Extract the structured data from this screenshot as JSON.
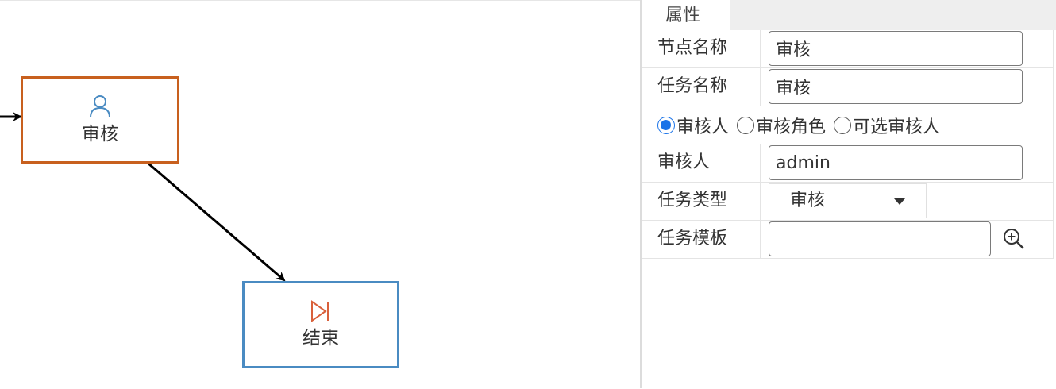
{
  "canvas": {
    "nodes": [
      {
        "id": "review",
        "label": "审核",
        "icon": "user-icon",
        "border_color": "#c8601e"
      },
      {
        "id": "end",
        "label": "结束",
        "icon": "end-event-icon",
        "border_color": "#4a8bc2"
      }
    ],
    "edge_color": "#000000"
  },
  "panel": {
    "tab_label": "属性",
    "fields": {
      "node_name": {
        "label": "节点名称",
        "value": "审核"
      },
      "task_name": {
        "label": "任务名称",
        "value": "审核"
      },
      "reviewer_mode": {
        "options": [
          "审核人",
          "审核角色",
          "可选审核人"
        ],
        "selected": "审核人"
      },
      "reviewer": {
        "label": "审核人",
        "value": "admin"
      },
      "task_type": {
        "label": "任务类型",
        "value": "审核",
        "icon": "chevron-down-icon"
      },
      "task_template": {
        "label": "任务模板",
        "value": "",
        "icon": "zoom-in-icon"
      }
    },
    "accent_color": "#1a73e8"
  }
}
